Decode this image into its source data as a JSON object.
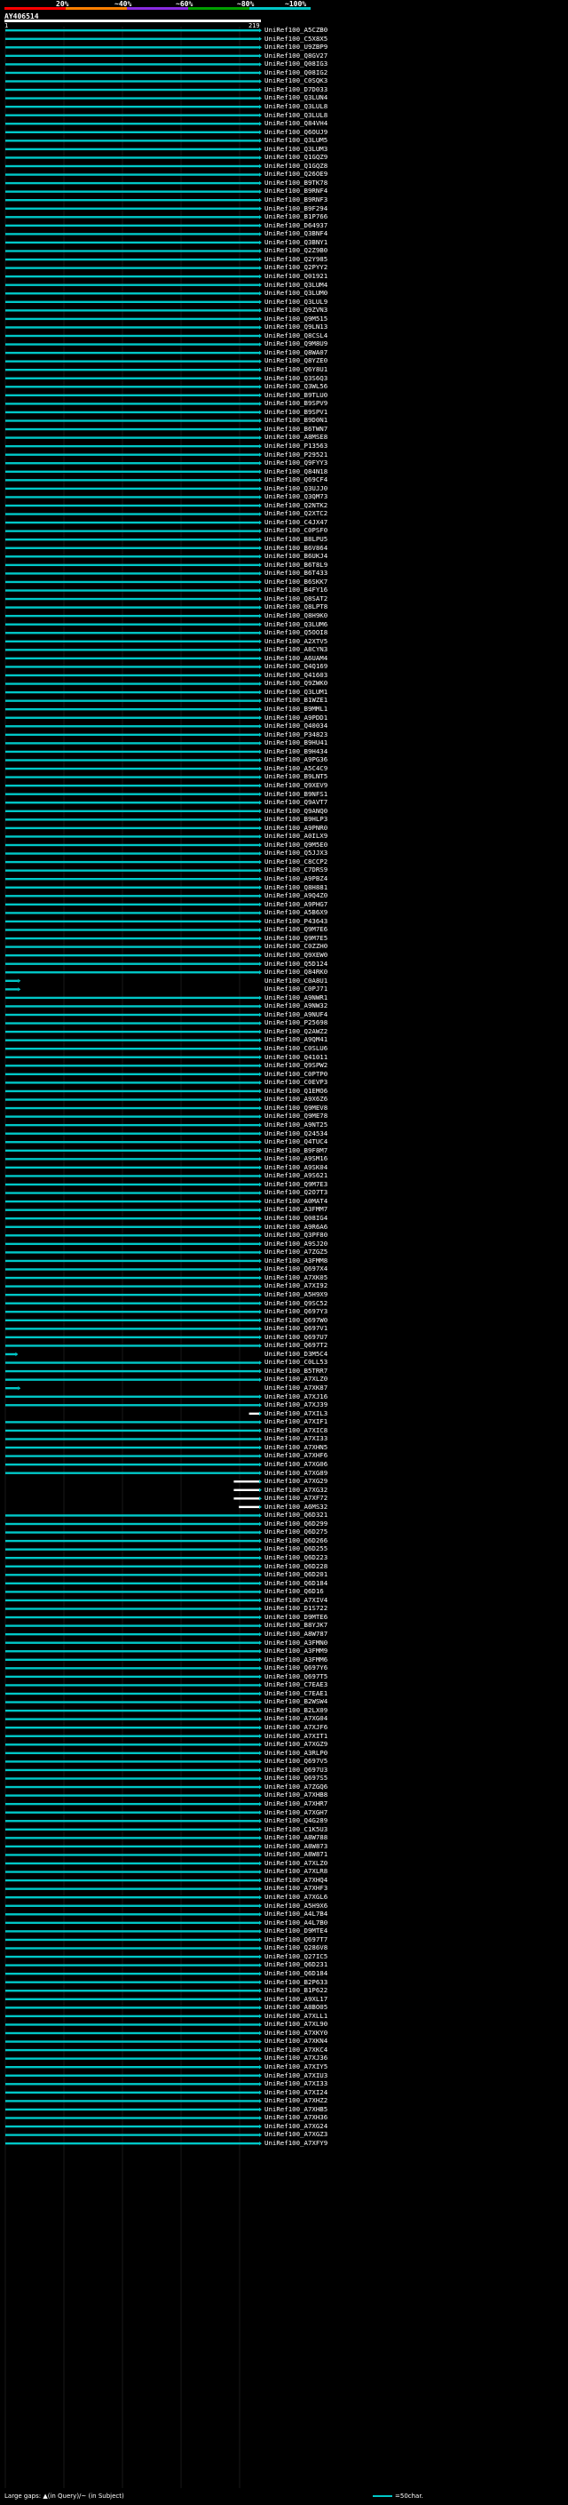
{
  "header": {
    "scale_labels": [
      "20%",
      "~40%",
      "~60%",
      "~80%",
      "~100%"
    ],
    "scale_colors": [
      "#ff0000",
      "#ff7f00",
      "#8a2be2",
      "#00a000",
      "#00c8c8"
    ]
  },
  "query": {
    "name": "AY406514",
    "start": "1",
    "end": "219"
  },
  "legend": {
    "gaps_text": "Large gaps: ▲(in Query)/~ (in Subject)",
    "scale_text": "=50char.",
    "hit_color": "#00c8c8"
  },
  "chart_data": {
    "type": "alignment",
    "query_length": 219,
    "hits": [
      "UniRef100_A5CZB0",
      "UniRef100_C5X8X5",
      "UniRef100_U9ZBP9",
      "UniRef100_Q8GV27",
      "UniRef100_Q08IG3",
      "UniRef100_Q08IG2",
      "UniRef100_C0SQK3",
      "UniRef100_D7D033",
      "UniRef100_Q3LUN4",
      "UniRef100_Q3LUL8",
      "UniRef100_Q3LUL8",
      "UniRef100_Q84VH4",
      "UniRef100_Q6OUJ9",
      "UniRef100_Q3LUM5",
      "UniRef100_Q3LUM3",
      "UniRef100_Q1GQZ9",
      "UniRef100_Q1GQZ8",
      "UniRef100_Q26OE9",
      "UniRef100_B9TK78",
      "UniRef100_B9RNF4",
      "UniRef100_B9RNF3",
      "UniRef100_B9F294",
      "UniRef100_B1P766",
      "UniRef100_D64937",
      "UniRef100_Q3BNF4",
      "UniRef100_Q3BNY1",
      "UniRef100_Q2Z9B0",
      "UniRef100_Q2Y985",
      "UniRef100_Q2PYY2",
      "UniRef100_Q01921",
      "UniRef100_Q3LUM4",
      "UniRef100_Q3LUM0",
      "UniRef100_Q3LUL9",
      "UniRef100_Q9ZVN3",
      "UniRef100_Q9M515",
      "UniRef100_Q9LN13",
      "UniRef100_Q8CSL4",
      "UniRef100_Q9M8U9",
      "UniRef100_Q8WA07",
      "UniRef100_Q8YZE0",
      "UniRef100_Q6Y8U1",
      "UniRef100_Q3S6Q3",
      "UniRef100_Q3WL56",
      "UniRef100_B9TLU0",
      "UniRef100_B9SPV9",
      "UniRef100_B9SPV1",
      "UniRef100_B9D0N1",
      "UniRef100_B6TWN7",
      "UniRef100_A8MSE8",
      "UniRef100_P13563",
      "UniRef100_P29521",
      "UniRef100_Q9FYY3",
      "UniRef100_Q84N18",
      "UniRef100_Q69CF4",
      "UniRef100_Q3UJJ0",
      "UniRef100_Q3QM73",
      "UniRef100_Q2NTK2",
      "UniRef100_Q2XTC2",
      "UniRef100_C4JX47",
      "UniRef100_C0PSF0",
      "UniRef100_B8LPU5",
      "UniRef100_B6V864",
      "UniRef100_B6UKJ4",
      "UniRef100_B6T8L9",
      "UniRef100_B6T433",
      "UniRef100_B6SKK7",
      "UniRef100_B4FY16",
      "UniRef100_Q8SAT2",
      "UniRef100_Q8LPT8",
      "UniRef100_Q8H9K0",
      "UniRef100_Q3LUM6",
      "UniRef100_Q5OOI8",
      "UniRef100_A2XTV5",
      "UniRef100_A8CYN3",
      "UniRef100_A6UAM4",
      "UniRef100_Q4Q169",
      "UniRef100_Q41603",
      "UniRef100_Q9ZWK0",
      "UniRef100_Q3LUM1",
      "UniRef100_B1WZE1",
      "UniRef100_B9MML1",
      "UniRef100_A9PDD1",
      "UniRef100_Q40034",
      "UniRef100_P34823",
      "UniRef100_B9HU41",
      "UniRef100_B9H434",
      "UniRef100_A9PG36",
      "UniRef100_A5C4C9",
      "UniRef100_B9LNT5",
      "UniRef100_Q9XEV9",
      "UniRef100_B9NFS1",
      "UniRef100_Q9AVT7",
      "UniRef100_Q9ANQ0",
      "UniRef100_B9HLP3",
      "UniRef100_A9PNR0",
      "UniRef100_A0ILX9",
      "UniRef100_Q9M5E0",
      "UniRef100_Q5JJX3",
      "UniRef100_C8CCP2",
      "UniRef100_C7DRS9",
      "UniRef100_A9PBZ4",
      "UniRef100_Q8H881",
      "UniRef100_A9Q4Z0",
      "UniRef100_A9PHG7",
      "UniRef100_A5B6X9",
      "UniRef100_P43643",
      "UniRef100_Q9M7E6",
      "UniRef100_Q9M7E5",
      "UniRef100_C0ZZH0",
      "UniRef100_Q9XEW0",
      "UniRef100_Q5D124",
      "UniRef100_Q84RK0",
      "UniRef100_C0A8U1",
      "UniRef100_C0PJ71",
      "UniRef100_A9NWR1",
      "UniRef100_A9NW32",
      "UniRef100_A9NUF4",
      "UniRef100_P25698",
      "UniRef100_Q2AWZ2",
      "UniRef100_A9QM41",
      "UniRef100_C0SLU6",
      "UniRef100_Q41011",
      "UniRef100_Q9SPW2",
      "UniRef100_C0PTP0",
      "UniRef100_C0EVP3",
      "UniRef100_Q1EMO6",
      "UniRef100_A9X6Z6",
      "UniRef100_Q9MEV8",
      "UniRef100_Q9ME78",
      "UniRef100_A9NT25",
      "UniRef100_Q24534",
      "UniRef100_Q4TUC4",
      "UniRef100_B9F8M7",
      "UniRef100_A9SM16",
      "UniRef100_A9SK04",
      "UniRef100_A9S621",
      "UniRef100_Q9M7E3",
      "UniRef100_Q2O7T3",
      "UniRef100_A0MAT4",
      "UniRef100_A3FMM7",
      "UniRef100_Q08IG4",
      "UniRef100_A9R6A6",
      "UniRef100_Q3PF80",
      "UniRef100_A9SJ20",
      "UniRef100_A7ZGZ5",
      "UniRef100_A3FMM8",
      "UniRef100_Q697X4",
      "UniRef100_A7XK05",
      "UniRef100_A7XI92",
      "UniRef100_A5H9X9",
      "UniRef100_Q9SC52",
      "UniRef100_Q697Y3",
      "UniRef100_Q697W0",
      "UniRef100_Q697V1",
      "UniRef100_Q697U7",
      "UniRef100_Q697T2",
      "UniRef100_D3M5C4",
      "UniRef100_C0LL53",
      "UniRef100_B5TRR7",
      "UniRef100_A7XLZ0",
      "UniRef100_A7XK87",
      "UniRef100_A7XJ16",
      "UniRef100_A7XJ39",
      "UniRef100_A7XIL3",
      "UniRef100_A7XIF1",
      "UniRef100_A7XIC8",
      "UniRef100_A7XI33",
      "UniRef100_A7XHN5",
      "UniRef100_A7XHF6",
      "UniRef100_A7XG06",
      "UniRef100_A7XG89",
      "UniRef100_A7XG29",
      "UniRef100_A7XG32",
      "UniRef100_A7XF72",
      "UniRef100_A6MS32",
      "UniRef100_Q6D321",
      "UniRef100_Q6D299",
      "UniRef100_Q6D275",
      "UniRef100_Q6D266",
      "UniRef100_Q6D255",
      "UniRef100_Q6D223",
      "UniRef100_Q6D228",
      "UniRef100_Q6D201",
      "UniRef100_Q6D184",
      "UniRef100_Q6D16",
      "UniRef100_A7XIV4",
      "UniRef100_D1S722",
      "UniRef100_D9MTE6",
      "UniRef100_B8YJK7",
      "UniRef100_A8W787",
      "UniRef100_A3FMN0",
      "UniRef100_A3FMM9",
      "UniRef100_A3FMM6",
      "UniRef100_Q697Y6",
      "UniRef100_Q697T5",
      "UniRef100_C7EAE3",
      "UniRef100_C7EAE1",
      "UniRef100_B2WSW4",
      "UniRef100_B2LX09",
      "UniRef100_A7XG04",
      "UniRef100_A7XJF6",
      "UniRef100_A7XIT1",
      "UniRef100_A7XGZ9",
      "UniRef100_A3RLP0",
      "UniRef100_Q697V5",
      "UniRef100_Q697U3",
      "UniRef100_Q697S5",
      "UniRef100_A7ZGQ6",
      "UniRef100_A7XHB8",
      "UniRef100_A7XHR7",
      "UniRef100_A7XGH7",
      "UniRef100_Q4G289",
      "UniRef100_C1K5U3",
      "UniRef100_A8W788",
      "UniRef100_A8W873",
      "UniRef100_A8W871",
      "UniRef100_A7XLZ0",
      "UniRef100_A7XLR8",
      "UniRef100_A7XHQ4",
      "UniRef100_A7XHF3",
      "UniRef100_A7XGL6",
      "UniRef100_A5H9X6",
      "UniRef100_A4L7B4",
      "UniRef100_A4L7B0",
      "UniRef100_D9MTE4",
      "UniRef100_Q697T7",
      "UniRef100_Q286V8",
      "UniRef100_Q27IC5",
      "UniRef100_Q6D231",
      "UniRef100_Q6D184",
      "UniRef100_B2P633",
      "UniRef100_B1P622",
      "UniRef100_A9XL17",
      "UniRef100_A8BO05",
      "UniRef100_A7XLL1",
      "UniRef100_A7XL90",
      "UniRef100_A7XKY0",
      "UniRef100_A7XKN4",
      "UniRef100_A7XKC4",
      "UniRef100_A7XJ36",
      "UniRef100_A7XIY5",
      "UniRef100_A7XIU3",
      "UniRef100_A7XI33",
      "UniRef100_A7XI24",
      "UniRef100_A7XHZ2",
      "UniRef100_A7XHB5",
      "UniRef100_A7XH36",
      "UniRef100_A7XG24",
      "UniRef100_A7XGZ3",
      "UniRef100_A7XFY9"
    ],
    "partial_hits": {
      "112": 0.05,
      "113": 0.05,
      "156": 0.04,
      "160": 0.05,
      "163": 0.96,
      "171": 0.9,
      "172": 0.9,
      "173": 0.9,
      "174": 0.92
    }
  }
}
